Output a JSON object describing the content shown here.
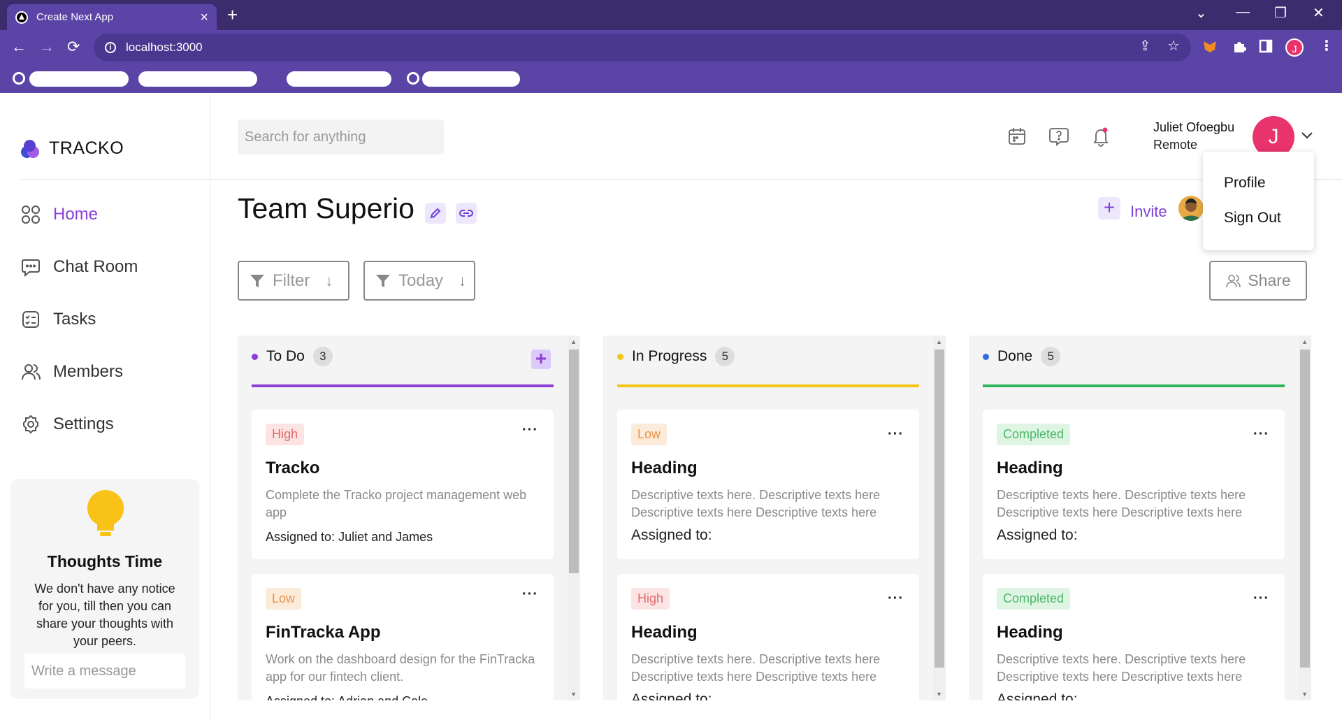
{
  "browser": {
    "tab_title": "Create Next App",
    "url": "localhost:3000"
  },
  "app": {
    "brand": "TRACKO",
    "search_placeholder": "Search for anything",
    "user": {
      "name": "Juliet Ofoegbu",
      "role": "Remote",
      "initial": "J"
    },
    "dropdown": {
      "profile": "Profile",
      "sign_out": "Sign Out"
    },
    "accent_color": "#8d3fd6"
  },
  "sidebar": {
    "items": [
      {
        "label": "Home",
        "icon": "grid-icon",
        "active": true
      },
      {
        "label": "Chat Room",
        "icon": "chat-icon",
        "active": false
      },
      {
        "label": "Tasks",
        "icon": "tasks-icon",
        "active": false
      },
      {
        "label": "Members",
        "icon": "members-icon",
        "active": false
      },
      {
        "label": "Settings",
        "icon": "gear-icon",
        "active": false
      }
    ],
    "thoughts": {
      "title": "Thoughts Time",
      "body": "We don't have any notice for you, till then you can share your thoughts with your peers.",
      "placeholder": "Write a message"
    }
  },
  "main": {
    "title": "Team Superio",
    "invite_label": "Invite",
    "filter_label": "Filter",
    "today_label": "Today",
    "share_label": "Share"
  },
  "columns": [
    {
      "name": "To Do",
      "count": "3",
      "color": "#8d3fd6",
      "cards": [
        {
          "badge": "High",
          "title": "Tracko",
          "desc": "Complete the Tracko project management web app",
          "assigned": "Assigned to: Juliet and James"
        },
        {
          "badge": "Low",
          "title": "FinTracka App",
          "desc": "Work on the dashboard design for the FinTracka app for our fintech client.",
          "assigned": "Assigned to: Adrian and Cole"
        }
      ]
    },
    {
      "name": "In Progress",
      "count": "5",
      "color": "#f5c518",
      "cards": [
        {
          "badge": "Low",
          "title": "Heading",
          "desc": "Descriptive texts here. Descriptive texts here Descriptive texts here Descriptive texts here",
          "assigned": "Assigned to:"
        },
        {
          "badge": "High",
          "title": "Heading",
          "desc": "Descriptive texts here. Descriptive texts here Descriptive texts here Descriptive texts here",
          "assigned": "Assigned to:"
        }
      ]
    },
    {
      "name": "Done",
      "count": "5",
      "color": "#2f9e4f",
      "cards": [
        {
          "badge": "Completed",
          "title": "Heading",
          "desc": "Descriptive texts here. Descriptive texts here Descriptive texts here Descriptive texts here",
          "assigned": "Assigned to:"
        },
        {
          "badge": "Completed",
          "title": "Heading",
          "desc": "Descriptive texts here. Descriptive texts here Descriptive texts here Descriptive texts here",
          "assigned": "Assigned to:"
        }
      ]
    }
  ]
}
